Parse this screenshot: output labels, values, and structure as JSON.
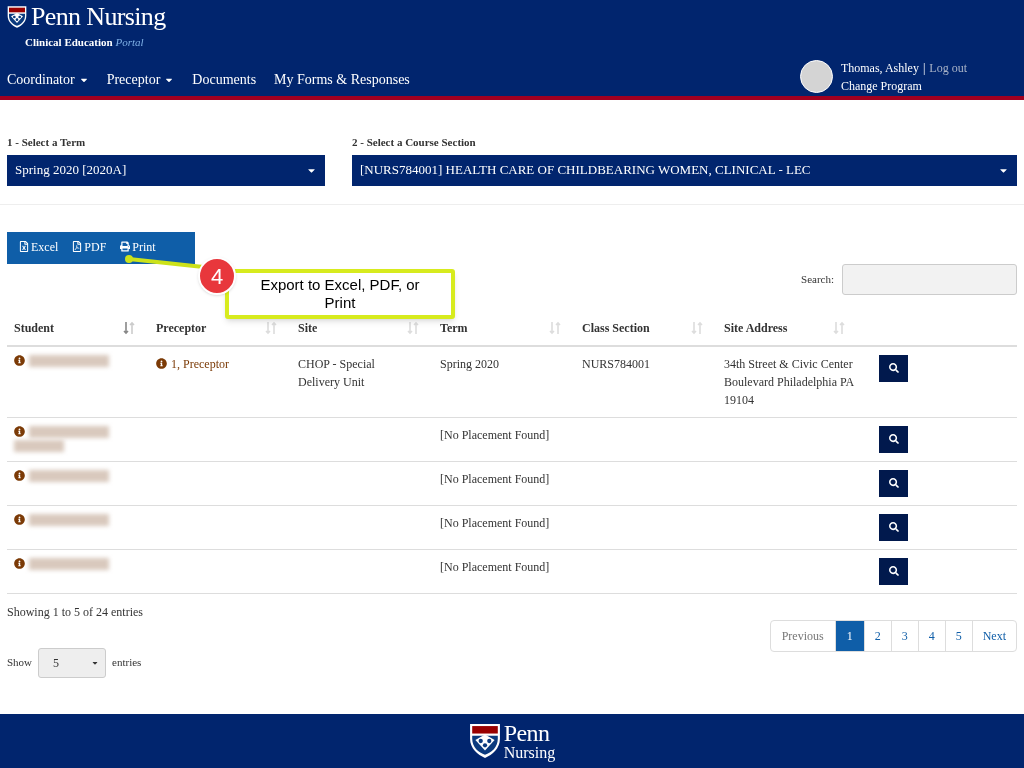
{
  "header": {
    "brand": "Penn Nursing",
    "subtitle": "Clinical Education",
    "subtitle_accent": "Portal",
    "nav": [
      {
        "label": "Coordinator",
        "dropdown": true
      },
      {
        "label": "Preceptor",
        "dropdown": true
      },
      {
        "label": "Documents",
        "dropdown": false
      },
      {
        "label": "My Forms & Responses",
        "dropdown": false
      }
    ],
    "user": {
      "name": "Thomas, Ashley",
      "separator": "|",
      "logout": "Log out",
      "change_program": "Change Program"
    }
  },
  "filters": [
    {
      "label": "1 - Select a Term",
      "value": "Spring 2020 [2020A]"
    },
    {
      "label": "2 - Select a Course Section",
      "value": "[NURS784001] HEALTH CARE OF CHILDBEARING WOMEN, CLINICAL - LEC"
    }
  ],
  "export_buttons": [
    {
      "kind": "excel",
      "label": "Excel"
    },
    {
      "kind": "pdf",
      "label": "PDF"
    },
    {
      "kind": "print",
      "label": "Print"
    }
  ],
  "callout": {
    "number": "4",
    "text": "Export to Excel, PDF, or Print"
  },
  "search": {
    "label": "Search:"
  },
  "table": {
    "columns": [
      {
        "label": "Student",
        "sorted": true
      },
      {
        "label": "Preceptor",
        "sorted": false
      },
      {
        "label": "Site",
        "sorted": false
      },
      {
        "label": "Term",
        "sorted": false
      },
      {
        "label": "Class Section",
        "sorted": false
      },
      {
        "label": "Site Address",
        "sorted": false
      }
    ],
    "rows": [
      {
        "name_wrapped": false,
        "preceptor": "1, Preceptor",
        "site": "CHOP - Special Delivery Unit",
        "term": "Spring 2020",
        "class_section": "NURS784001",
        "site_address": "34th Street & Civic Center Boulevard Philadelphia PA 19104"
      },
      {
        "name_wrapped": true,
        "term": "[No Placement Found]"
      },
      {
        "name_wrapped": false,
        "term": "[No Placement Found]"
      },
      {
        "name_wrapped": false,
        "term": "[No Placement Found]"
      },
      {
        "name_wrapped": false,
        "term": "[No Placement Found]"
      }
    ]
  },
  "info": "Showing 1 to 5 of 24 entries",
  "pagination": [
    {
      "label": "Previous",
      "selected": false
    },
    {
      "label": "1",
      "selected": true
    },
    {
      "label": "2",
      "selected": false
    },
    {
      "label": "3",
      "selected": false
    },
    {
      "label": "4",
      "selected": false
    },
    {
      "label": "5",
      "selected": false
    },
    {
      "label": "Next",
      "selected": false
    }
  ],
  "length": {
    "before": "Show",
    "value": "5",
    "after": "entries"
  },
  "footer": {
    "brand_line1": "Penn",
    "brand_line2": "Nursing"
  }
}
